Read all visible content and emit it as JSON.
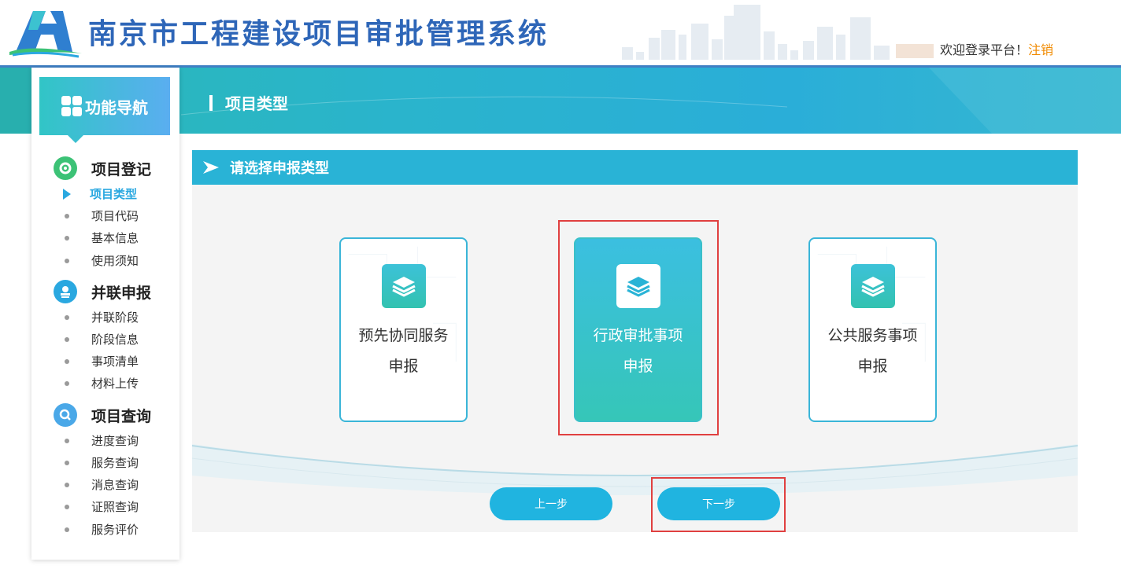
{
  "header": {
    "title": "南京市工程建设项目审批管理系统",
    "welcome": "欢迎登录平台！",
    "logout": "注销",
    "logo_icon": "city-logo-icon"
  },
  "banner": {
    "heading": "项目类型"
  },
  "sidebar": {
    "title": "功能导航",
    "groups": [
      {
        "label": "项目登记",
        "icon": "gear-icon",
        "color": "#3cc276",
        "items": [
          "项目类型",
          "项目代码",
          "基本信息",
          "使用须知"
        ]
      },
      {
        "label": "并联申报",
        "icon": "stamp-icon",
        "color": "#2aa8e0",
        "items": [
          "并联阶段",
          "阶段信息",
          "事项清单",
          "材料上传"
        ]
      },
      {
        "label": "项目查询",
        "icon": "search-icon",
        "color": "#4aa8e8",
        "items": [
          "进度查询",
          "服务查询",
          "消息查询",
          "证照查询",
          "服务评价"
        ]
      }
    ],
    "active_item": "项目类型"
  },
  "section": {
    "title": "请选择申报类型"
  },
  "cards": [
    {
      "line1": "预先协同服务",
      "line2": "申报",
      "selected": false,
      "icon": "layers-icon"
    },
    {
      "line1": "行政审批事项",
      "line2": "申报",
      "selected": true,
      "icon": "layers-icon"
    },
    {
      "line1": "公共服务事项",
      "line2": "申报",
      "selected": false,
      "icon": "layers-icon"
    }
  ],
  "buttons": {
    "prev": "上一步",
    "next": "下一步"
  },
  "colors": {
    "accent": "#29b3d6",
    "title_blue": "#2e66b8",
    "highlight_red": "#e04040",
    "logout_orange": "#f08a00"
  }
}
